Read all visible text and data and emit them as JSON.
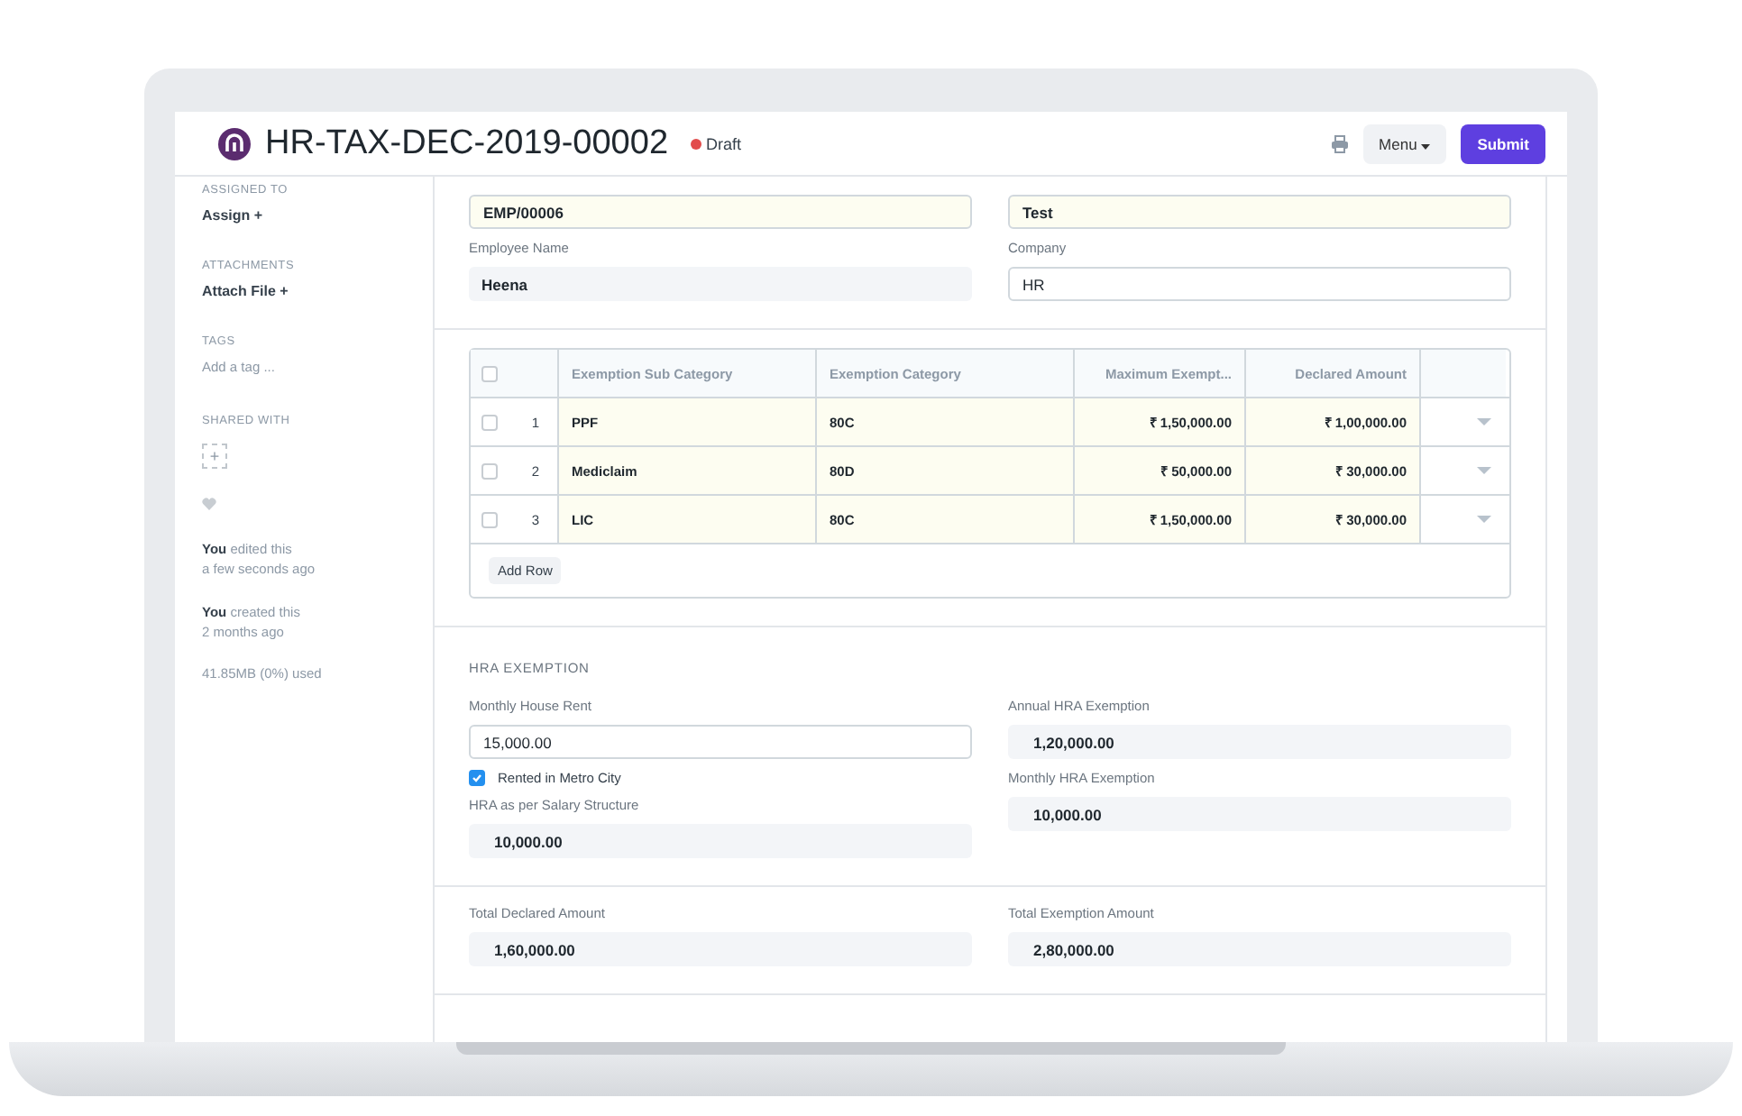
{
  "header": {
    "title": "HR-TAX-DEC-2019-00002",
    "status": {
      "label": "Draft",
      "color": "#e24c4c"
    },
    "menu": "Menu",
    "submit": "Submit"
  },
  "sidebar": {
    "assigned_label": "ASSIGNED TO",
    "assign": "Assign +",
    "attachments_label": "ATTACHMENTS",
    "attach": "Attach File +",
    "tags_label": "TAGS",
    "tag_placeholder": "Add a tag ...",
    "shared_label": "SHARED WITH",
    "share_button": "+",
    "activity": [
      {
        "who": "You",
        "what": "edited this",
        "when": "a few seconds ago"
      },
      {
        "who": "You",
        "what": "created this",
        "when": "2 months ago"
      }
    ],
    "usage": "41.85MB (0%) used"
  },
  "top_fields": [
    {
      "value": "EMP/00006",
      "kind": "link"
    },
    {
      "value": "Test",
      "kind": "link"
    },
    {
      "label": "Employee Name",
      "value": "Heena",
      "kind": "readonly"
    },
    {
      "label": "Company",
      "value": "HR",
      "kind": "input"
    }
  ],
  "table": {
    "select_all": false,
    "columns": [
      "Exemption Sub Category",
      "Exemption Category",
      "Maximum Exempt...",
      "Declared Amount"
    ],
    "rows": [
      {
        "no": "1",
        "checked": false,
        "cells": [
          "PPF",
          "80C",
          "₹ 1,50,000.00",
          "₹ 1,00,000.00"
        ]
      },
      {
        "no": "2",
        "checked": false,
        "cells": [
          "Mediclaim",
          "80D",
          "₹ 50,000.00",
          "₹ 30,000.00"
        ]
      },
      {
        "no": "3",
        "checked": false,
        "cells": [
          "LIC",
          "80C",
          "₹ 1,50,000.00",
          "₹ 30,000.00"
        ]
      }
    ],
    "add_row": "Add Row"
  },
  "hra": {
    "heading": "HRA EXEMPTION",
    "rent_label": "Monthly House Rent",
    "rent": "15,000.00",
    "metro_label": "Rented in Metro City",
    "metro": true,
    "salary_label": "HRA as per Salary Structure",
    "salary": "10,000.00",
    "annual_label": "Annual HRA Exemption",
    "annual": "1,20,000.00",
    "monthly_label": "Monthly HRA Exemption",
    "monthly": "10,000.00"
  },
  "totals": [
    {
      "label": "Total Declared Amount",
      "value": "1,60,000.00"
    },
    {
      "label": "Total Exemption Amount",
      "value": "2,80,000.00"
    }
  ]
}
